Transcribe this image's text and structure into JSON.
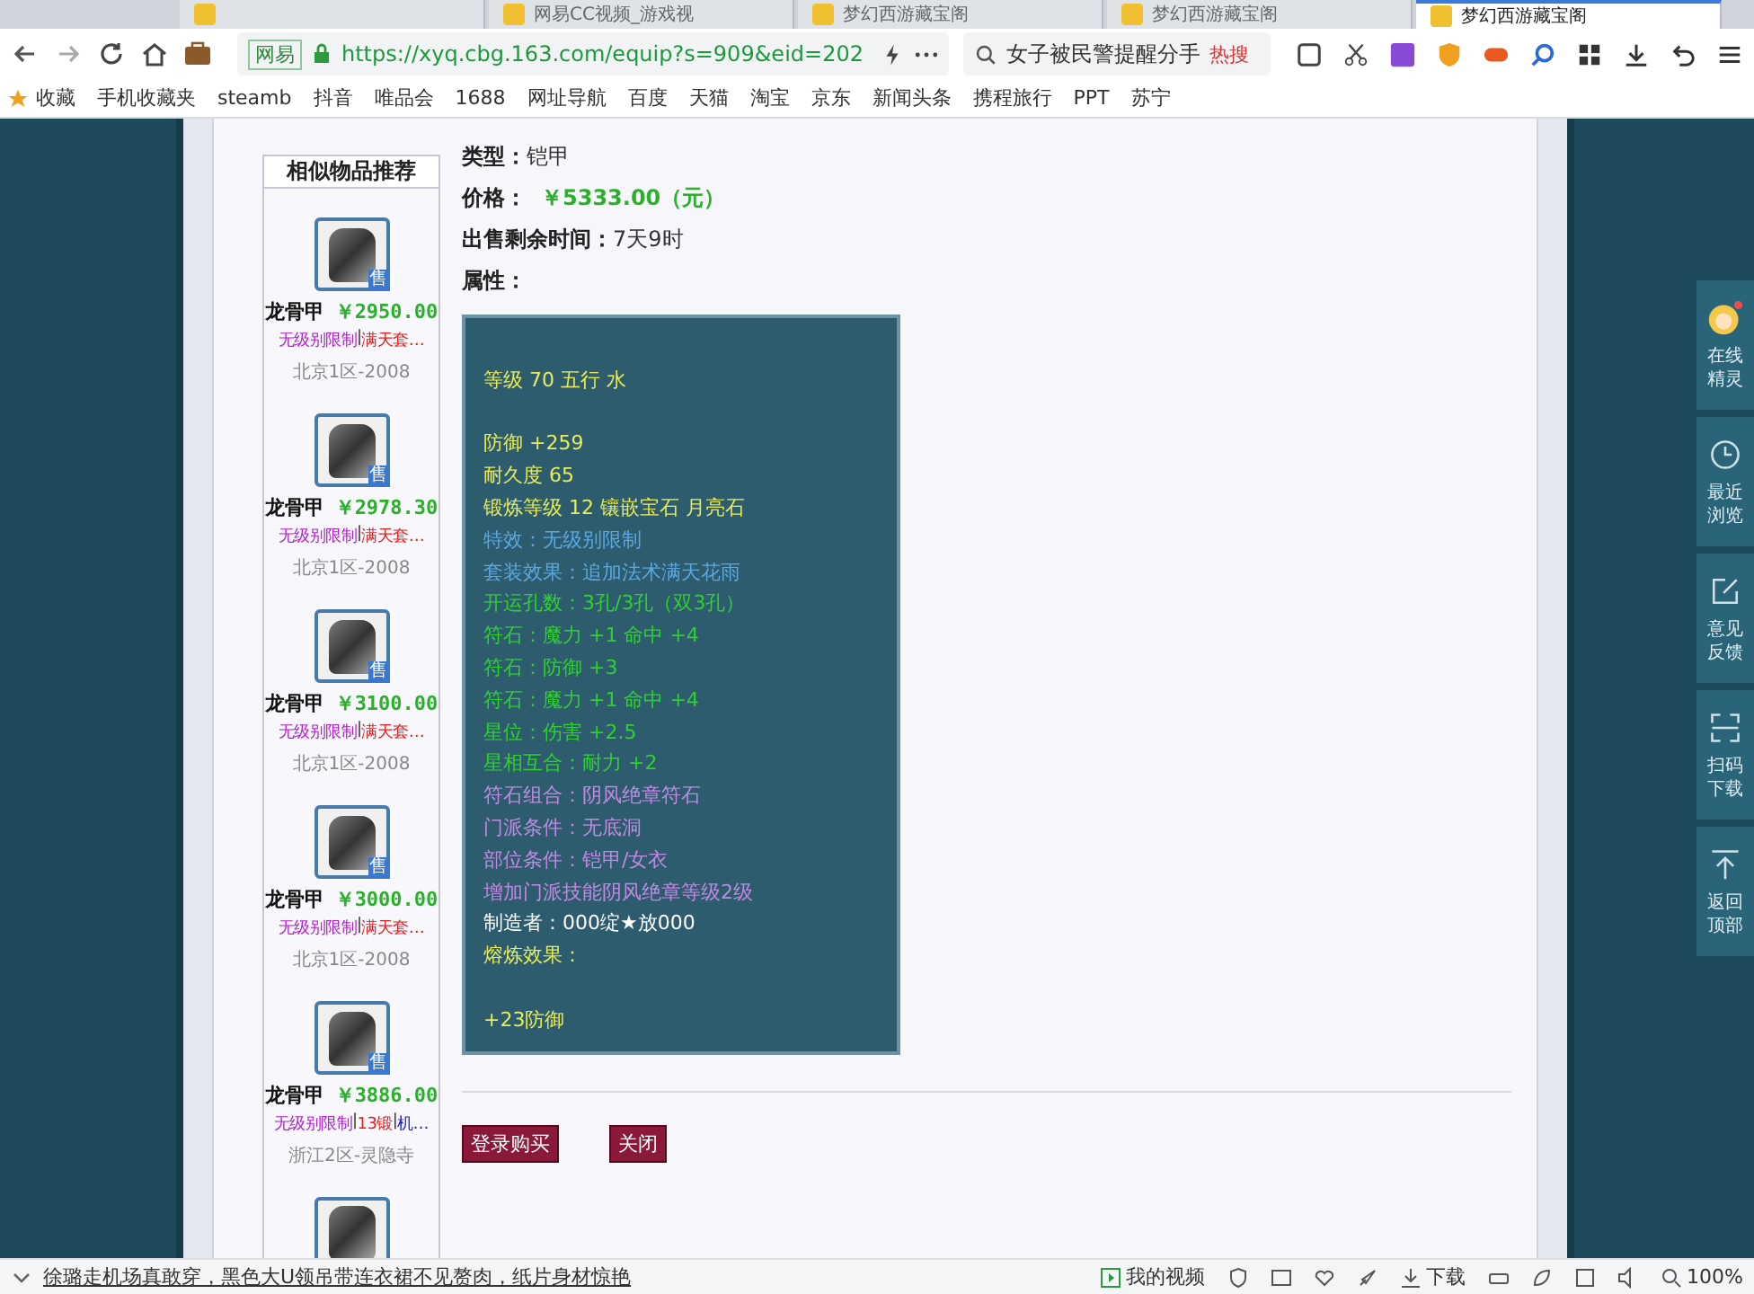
{
  "tabs": [
    {
      "selected": false
    },
    {
      "title": "网易CC视频_游戏视",
      "selected": false
    },
    {
      "title": "梦幻西游藏宝阁",
      "selected": false
    },
    {
      "title": "梦幻西游藏宝阁",
      "selected": false
    },
    {
      "title": "梦幻西游藏宝阁",
      "selected": true
    }
  ],
  "toolbar": {
    "site_badge": "网易",
    "url": "https://xyq.cbg.163.com/equip?s=909&eid=202",
    "search_value": "女子被民警提醒分手",
    "hot_label": "热搜"
  },
  "bookmarks": [
    "收藏",
    "手机收藏夹",
    "steamb",
    "抖音",
    "唯品会",
    "1688",
    "网址导航",
    "百度",
    "天猫",
    "淘宝",
    "京东",
    "新闻头条",
    "携程旅行",
    "PPT",
    "苏宁"
  ],
  "sidebar": {
    "title": "相似物品推荐",
    "tag_separator": "|",
    "items": [
      {
        "badge": "售",
        "name": "龙骨甲",
        "price": "￥2950.00",
        "tags": [
          {
            "text": "无级别限制",
            "color": "#b020d0"
          },
          {
            "text": "满天套…",
            "color": "#e02020"
          }
        ],
        "server": "北京1区-2008"
      },
      {
        "badge": "售",
        "name": "龙骨甲",
        "price": "￥2978.30",
        "tags": [
          {
            "text": "无级别限制",
            "color": "#b020d0"
          },
          {
            "text": "满天套…",
            "color": "#e02020"
          }
        ],
        "server": "北京1区-2008"
      },
      {
        "badge": "售",
        "name": "龙骨甲",
        "price": "￥3100.00",
        "tags": [
          {
            "text": "无级别限制",
            "color": "#b020d0"
          },
          {
            "text": "满天套…",
            "color": "#e02020"
          }
        ],
        "server": "北京1区-2008"
      },
      {
        "badge": "售",
        "name": "龙骨甲",
        "price": "￥3000.00",
        "tags": [
          {
            "text": "无级别限制",
            "color": "#b020d0"
          },
          {
            "text": "满天套…",
            "color": "#e02020"
          }
        ],
        "server": "北京1区-2008"
      },
      {
        "badge": "售",
        "name": "龙骨甲",
        "price": "￥3886.00",
        "tags": [
          {
            "text": "无级别限制",
            "color": "#b020d0"
          },
          {
            "text": "13锻",
            "color": "#e02020"
          },
          {
            "text": "机…",
            "color": "#2020c0"
          }
        ],
        "server": "浙江2区-灵隐寺"
      }
    ]
  },
  "details": [
    {
      "label": "类型：",
      "value": "铠甲",
      "kind": "plain"
    },
    {
      "label": "价格：",
      "value": "￥5333.00（元）",
      "kind": "price"
    },
    {
      "label": "出售剩余时间：",
      "value": "7天9时",
      "kind": "plain"
    },
    {
      "label": "属性：",
      "kind": "heading"
    }
  ],
  "attribute_groups": [
    [
      {
        "text": "等级 70 五行 水",
        "color": "#e8ec5a"
      }
    ],
    [
      {
        "text": "防御 +259",
        "color": "#e8ec5a"
      },
      {
        "text": "耐久度 65",
        "color": "#e8ec5a"
      },
      {
        "text": "锻炼等级 12 镶嵌宝石 月亮石",
        "color": "#e8ec5a"
      },
      {
        "text": "特效：无级别限制",
        "color": "#5aa8e0"
      },
      {
        "text": "套装效果：追加法术满天花雨",
        "color": "#5aa8e0"
      },
      {
        "text": "开运孔数：3孔/3孔（双3孔）",
        "color": "#30d030"
      },
      {
        "text": "符石：魔力 +1 命中 +4",
        "color": "#30d030"
      },
      {
        "text": "符石：防御 +3",
        "color": "#30d030"
      },
      {
        "text": "符石：魔力 +1 命中 +4",
        "color": "#30d030"
      },
      {
        "text": "星位：伤害 +2.5",
        "color": "#30d030"
      },
      {
        "text": "星相互合：耐力 +2",
        "color": "#30d030"
      },
      {
        "text": "符石组合：阴风绝章符石",
        "color": "#c08ae0"
      },
      {
        "text": "门派条件：无底洞",
        "color": "#c08ae0"
      },
      {
        "text": "部位条件：铠甲/女衣",
        "color": "#c08ae0"
      },
      {
        "text": "增加门派技能阴风绝章等级2级",
        "color": "#c08ae0"
      },
      {
        "text": "制造者：000绽★放000",
        "color": "#ffffff"
      },
      {
        "text": "熔炼效果：",
        "color": "#e8ec5a"
      }
    ],
    [
      {
        "text": "+23防御",
        "color": "#e8ec5a"
      }
    ]
  ],
  "buttons": [
    "登录购买",
    "关闭"
  ],
  "side_panel": [
    {
      "kind": "avatar",
      "lines": [
        "在线",
        "精灵"
      ]
    },
    {
      "kind": "clock",
      "lines": [
        "最近",
        "浏览"
      ]
    },
    {
      "kind": "edit",
      "lines": [
        "意见",
        "反馈"
      ]
    },
    {
      "kind": "scan",
      "lines": [
        "扫码",
        "下载"
      ]
    },
    {
      "kind": "top",
      "lines": [
        "返回",
        "顶部"
      ]
    }
  ],
  "status_bar": {
    "news": "徐璐走机场真敢穿，黑色大U领吊带连衣裙不见赘肉，纸片身材惊艳",
    "video": "我的视频",
    "download": "下载",
    "zoom": "100%"
  }
}
